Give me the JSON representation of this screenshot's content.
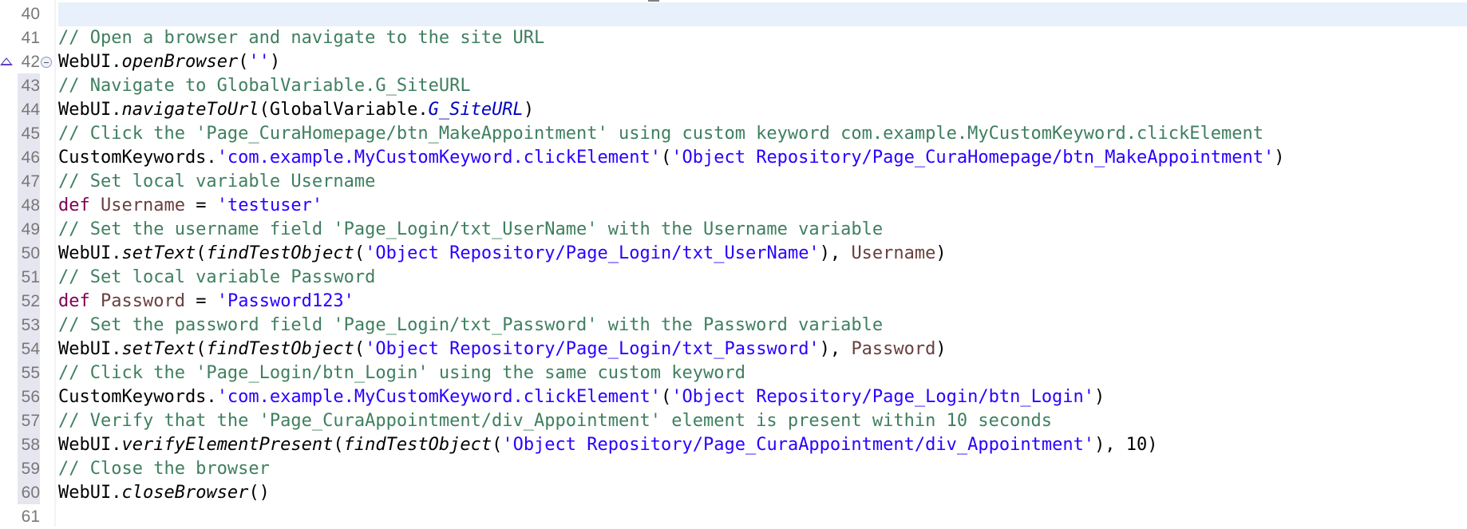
{
  "editor": {
    "current_line": 40,
    "lines": [
      {
        "n": "40",
        "tokens": []
      },
      {
        "n": "41",
        "tokens": [
          [
            "// Open a browser and navigate to the site URL",
            "c"
          ]
        ]
      },
      {
        "n": "42",
        "markers": [
          "warning-icon",
          "fold-collapse-icon"
        ],
        "tokens": [
          [
            "WebUI.",
            ""
          ],
          [
            "openBrowser",
            "m"
          ],
          [
            "(",
            ""
          ],
          [
            "''",
            "s"
          ],
          [
            ")",
            ""
          ]
        ]
      },
      {
        "n": "43",
        "tokens": [
          [
            "// Navigate to GlobalVariable.G_SiteURL",
            "c"
          ]
        ]
      },
      {
        "n": "44",
        "tokens": [
          [
            "WebUI.",
            ""
          ],
          [
            "navigateToUrl",
            "m"
          ],
          [
            "(GlobalVariable.",
            ""
          ],
          [
            "G_SiteURL",
            "f"
          ],
          [
            ")",
            ""
          ]
        ]
      },
      {
        "n": "45",
        "tokens": [
          [
            "// Click the 'Page_CuraHomepage/btn_MakeAppointment' using custom keyword com.example.MyCustomKeyword.clickElement",
            "c"
          ]
        ]
      },
      {
        "n": "46",
        "tokens": [
          [
            "CustomKeywords.",
            ""
          ],
          [
            "'com.example.MyCustomKeyword.clickElement'",
            "s"
          ],
          [
            "(",
            ""
          ],
          [
            "'Object Repository/Page_CuraHomepage/btn_MakeAppointment'",
            "s"
          ],
          [
            ")",
            ""
          ]
        ]
      },
      {
        "n": "47",
        "tokens": [
          [
            "// Set local variable Username",
            "c"
          ]
        ]
      },
      {
        "n": "48",
        "tokens": [
          [
            "def",
            "k"
          ],
          [
            " ",
            ""
          ],
          [
            "Username",
            "v"
          ],
          [
            " = ",
            ""
          ],
          [
            "'testuser'",
            "s"
          ]
        ]
      },
      {
        "n": "49",
        "tokens": [
          [
            "// Set the username field 'Page_Login/txt_UserName' with the Username variable",
            "c"
          ]
        ]
      },
      {
        "n": "50",
        "tokens": [
          [
            "WebUI.",
            ""
          ],
          [
            "setText",
            "m"
          ],
          [
            "(",
            ""
          ],
          [
            "findTestObject",
            "m"
          ],
          [
            "(",
            ""
          ],
          [
            "'Object Repository/Page_Login/txt_UserName'",
            "s"
          ],
          [
            "), ",
            ""
          ],
          [
            "Username",
            "v"
          ],
          [
            ")",
            ""
          ]
        ]
      },
      {
        "n": "51",
        "tokens": [
          [
            "// Set local variable Password",
            "c"
          ]
        ]
      },
      {
        "n": "52",
        "tokens": [
          [
            "def",
            "k"
          ],
          [
            " ",
            ""
          ],
          [
            "Password",
            "v"
          ],
          [
            " = ",
            ""
          ],
          [
            "'Password123'",
            "s"
          ]
        ]
      },
      {
        "n": "53",
        "tokens": [
          [
            "// Set the password field 'Page_Login/txt_Password' with the Password variable",
            "c"
          ]
        ]
      },
      {
        "n": "54",
        "tokens": [
          [
            "WebUI.",
            ""
          ],
          [
            "setText",
            "m"
          ],
          [
            "(",
            ""
          ],
          [
            "findTestObject",
            "m"
          ],
          [
            "(",
            ""
          ],
          [
            "'Object Repository/Page_Login/txt_Password'",
            "s"
          ],
          [
            "), ",
            ""
          ],
          [
            "Password",
            "v"
          ],
          [
            ")",
            ""
          ]
        ]
      },
      {
        "n": "55",
        "tokens": [
          [
            "// Click the 'Page_Login/btn_Login' using the same custom keyword",
            "c"
          ]
        ]
      },
      {
        "n": "56",
        "tokens": [
          [
            "CustomKeywords.",
            ""
          ],
          [
            "'com.example.MyCustomKeyword.clickElement'",
            "s"
          ],
          [
            "(",
            ""
          ],
          [
            "'Object Repository/Page_Login/btn_Login'",
            "s"
          ],
          [
            ")",
            ""
          ]
        ]
      },
      {
        "n": "57",
        "tokens": [
          [
            "// Verify that the 'Page_CuraAppointment/div_Appointment' element is present within 10 seconds",
            "c"
          ]
        ]
      },
      {
        "n": "58",
        "tokens": [
          [
            "WebUI.",
            ""
          ],
          [
            "verifyElementPresent",
            "m"
          ],
          [
            "(",
            ""
          ],
          [
            "findTestObject",
            "m"
          ],
          [
            "(",
            ""
          ],
          [
            "'Object Repository/Page_CuraAppointment/div_Appointment'",
            "s"
          ],
          [
            "), 10)",
            ""
          ]
        ]
      },
      {
        "n": "59",
        "tokens": [
          [
            "// Close the browser",
            "c"
          ]
        ]
      },
      {
        "n": "60",
        "tokens": [
          [
            "WebUI.",
            ""
          ],
          [
            "closeBrowser",
            "m"
          ],
          [
            "()",
            ""
          ]
        ]
      },
      {
        "n": "61",
        "tokens": []
      }
    ]
  }
}
